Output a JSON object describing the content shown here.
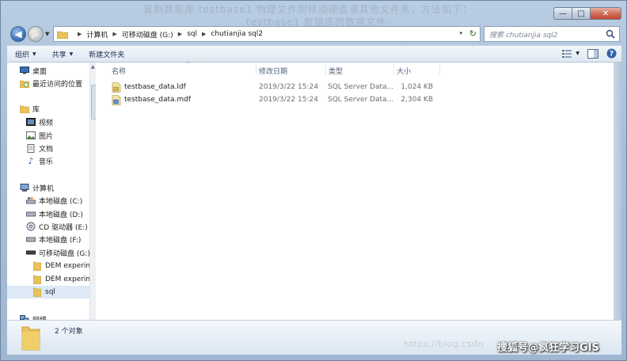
{
  "background_text": {
    "line1": "复制数据库 testbase1 物理文件到移动硬盘或其他文件夹，方法如下：",
    "line2": "testbase1 数据库的数据文件"
  },
  "window_controls": {
    "minimize": "—",
    "maximize": "□",
    "close": "✕"
  },
  "address_bar": {
    "crumbs": [
      "计算机",
      "可移动磁盘 (G:)",
      "sql",
      "chutianjia sql2"
    ],
    "dropdown": "▾",
    "refresh": "↻"
  },
  "search": {
    "placeholder": "搜索 chutianjia sql2"
  },
  "toolbar": {
    "organize": "组织",
    "share": "共享",
    "new_folder": "新建文件夹"
  },
  "nav_pane": {
    "favorites_desktop": "桌面",
    "favorites_recent": "最近访问的位置",
    "library": "库",
    "videos": "视频",
    "pictures": "图片",
    "documents": "文档",
    "music": "音乐",
    "computer": "计算机",
    "drive_c": "本地磁盘 (C:)",
    "drive_d": "本地磁盘 (D:)",
    "drive_e": "CD 驱动器 (E:)",
    "drive_f": "本地磁盘 (F:)",
    "drive_g": "可移动磁盘 (G:)",
    "folder_dem1": "DEM experim",
    "folder_dem2": "DEM experim",
    "folder_sql": "sql",
    "network": "网络"
  },
  "columns": {
    "name": "名称",
    "date": "修改日期",
    "type": "类型",
    "size": "大小"
  },
  "files": [
    {
      "name": "testbase_data.ldf",
      "date": "2019/3/22 15:24",
      "type": "SQL Server Data...",
      "size": "1,024 KB"
    },
    {
      "name": "testbase_data.mdf",
      "date": "2019/3/22 15:24",
      "type": "SQL Server Data...",
      "size": "2,304 KB"
    }
  ],
  "details": {
    "count": "2 个对象"
  },
  "watermarks": {
    "csdn": "https://blog.csdn",
    "sohu": "搜狐号@疯狂学习GIS"
  },
  "colors": {
    "accent": "#3f74b8",
    "folder": "#e8c25a",
    "selection": "#dde9f6"
  }
}
